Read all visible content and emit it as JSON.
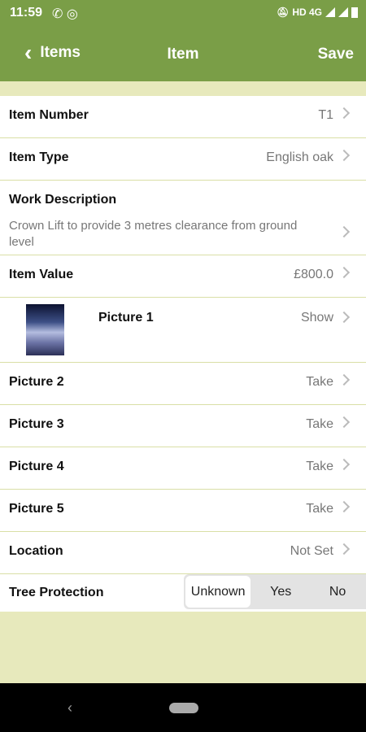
{
  "status": {
    "time": "11:59",
    "network": "HD 4G"
  },
  "appbar": {
    "back_label": "Items",
    "title": "Item",
    "save_label": "Save"
  },
  "rows": {
    "item_number": {
      "label": "Item Number",
      "value": "T1"
    },
    "item_type": {
      "label": "Item Type",
      "value": "English oak"
    },
    "work_description": {
      "label": "Work Description",
      "value": "Crown Lift to provide 3 metres clearance from ground level"
    },
    "item_value": {
      "label": "Item Value",
      "value": "£800.0"
    },
    "picture1": {
      "label": "Picture 1",
      "value": "Show"
    },
    "picture2": {
      "label": "Picture 2",
      "value": "Take"
    },
    "picture3": {
      "label": "Picture 3",
      "value": "Take"
    },
    "picture4": {
      "label": "Picture 4",
      "value": "Take"
    },
    "picture5": {
      "label": "Picture 5",
      "value": "Take"
    },
    "location": {
      "label": "Location",
      "value": "Not Set"
    },
    "tree_protection": {
      "label": "Tree Protection",
      "options": [
        "Unknown",
        "Yes",
        "No"
      ],
      "selected": "Unknown"
    }
  },
  "colors": {
    "primary": "#7a9e47",
    "background": "#e7e9bc",
    "divider": "#d9dfa6"
  }
}
